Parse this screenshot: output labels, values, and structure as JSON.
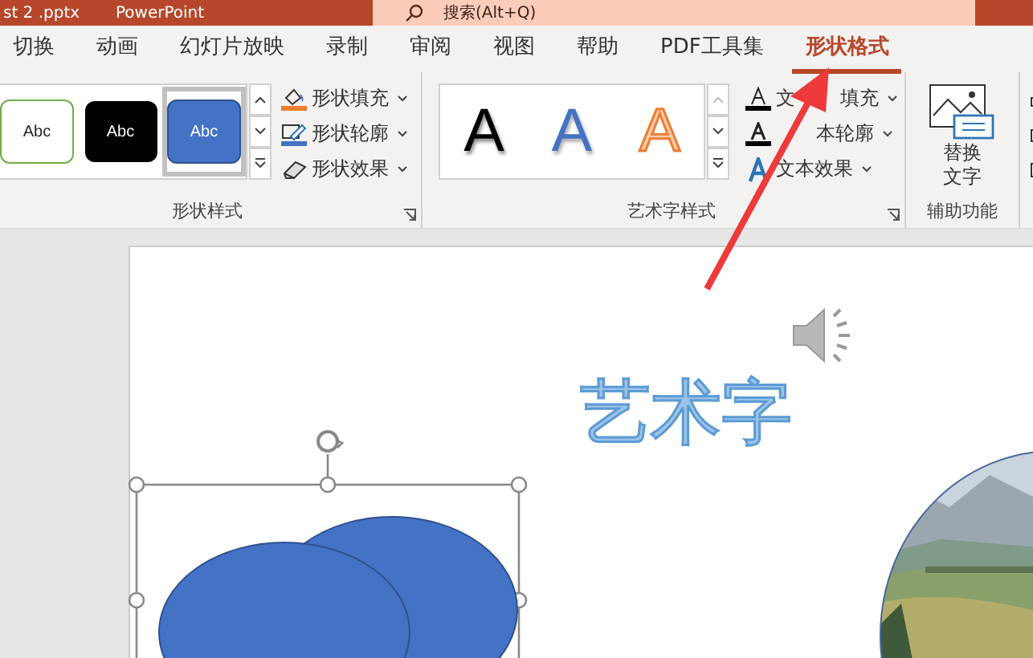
{
  "window": {
    "title": "st 2 .pptx",
    "app": "PowerPoint",
    "search": "搜索(Alt+Q)"
  },
  "tabs": [
    {
      "label": "切换",
      "selected": false
    },
    {
      "label": "动画",
      "selected": false
    },
    {
      "label": "幻灯片放映",
      "selected": false
    },
    {
      "label": "录制",
      "selected": false
    },
    {
      "label": "审阅",
      "selected": false
    },
    {
      "label": "视图",
      "selected": false
    },
    {
      "label": "帮助",
      "selected": false
    },
    {
      "label": "PDF工具集",
      "selected": false
    },
    {
      "label": "形状格式",
      "selected": true
    }
  ],
  "shape_styles": {
    "gallery": [
      {
        "text": "Abc",
        "kind": "outline",
        "selected": false
      },
      {
        "text": "Abc",
        "kind": "dark",
        "selected": false
      },
      {
        "text": "Abc",
        "kind": "blue",
        "selected": true
      }
    ],
    "commands": [
      {
        "label": "形状填充",
        "kind": "fill"
      },
      {
        "label": "形状轮廓",
        "kind": "outline"
      },
      {
        "label": "形状效果",
        "kind": "effects"
      }
    ],
    "group_label": "形状样式"
  },
  "wordart_styles": {
    "gallery": [
      {
        "text": "A",
        "kind": "black"
      },
      {
        "text": "A",
        "kind": "blue"
      },
      {
        "text": "A",
        "kind": "orange"
      }
    ],
    "commands": [
      {
        "label_parts": [
          "文",
          "填充"
        ],
        "covered_start": false,
        "kind": "fill"
      },
      {
        "label_parts": [
          "本轮廓"
        ],
        "covered_start": true,
        "kind": "outline"
      },
      {
        "label_parts": [
          "文本效果"
        ],
        "covered_start": false,
        "kind": "effects"
      }
    ],
    "group_label": "艺术字样式"
  },
  "accessibility": {
    "button": "替换文字",
    "group_label": "辅助功能"
  },
  "slide": {
    "wordart": "艺术字"
  }
}
